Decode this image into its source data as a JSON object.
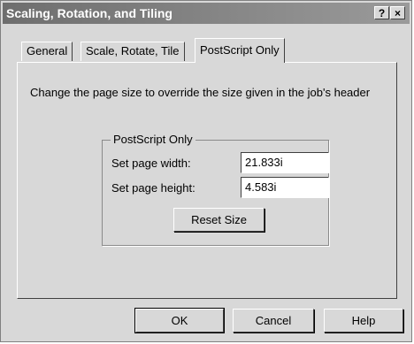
{
  "window": {
    "title": "Scaling, Rotation, and Tiling",
    "help_button": "?",
    "close_button": "×"
  },
  "tabs": [
    {
      "label": "General",
      "active": false
    },
    {
      "label": "Scale, Rotate, Tile",
      "active": false
    },
    {
      "label": "PostScript Only",
      "active": true
    }
  ],
  "panel": {
    "description": "Change the page size to override the size given in the job's header",
    "group": {
      "title": "PostScript Only",
      "width_label": "Set page width:",
      "width_value": "21.833i",
      "height_label": "Set page height:",
      "height_value": "4.583i",
      "reset_button": "Reset Size"
    }
  },
  "footer": {
    "ok": "OK",
    "cancel": "Cancel",
    "help": "Help"
  }
}
